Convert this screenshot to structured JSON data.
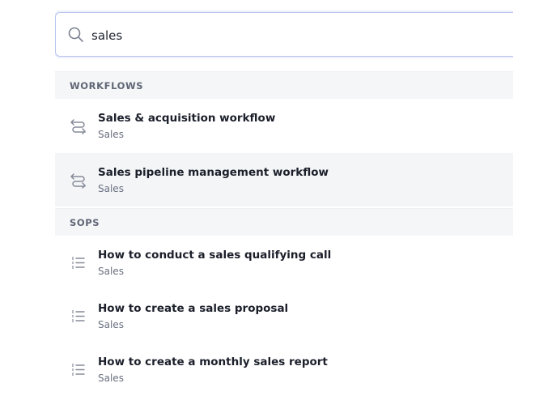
{
  "search": {
    "value": "sales",
    "icon": "search-icon"
  },
  "sections": [
    {
      "header": "WORKFLOWS",
      "icon": "workflow-icon",
      "items": [
        {
          "title": "Sales & acquisition workflow",
          "subtitle": "Sales"
        },
        {
          "title": "Sales pipeline management workflow",
          "subtitle": "Sales"
        }
      ]
    },
    {
      "header": "SOPS",
      "icon": "numbered-list-icon",
      "items": [
        {
          "title": "How to conduct a sales qualifying call",
          "subtitle": "Sales"
        },
        {
          "title": "How to create a sales proposal",
          "subtitle": "Sales"
        },
        {
          "title": "How to create a monthly sales report",
          "subtitle": "Sales"
        }
      ]
    }
  ],
  "colors": {
    "focus_border": "#b9c4f0",
    "section_bg": "#f5f6f8",
    "hover_bg": "#f4f5f7"
  }
}
